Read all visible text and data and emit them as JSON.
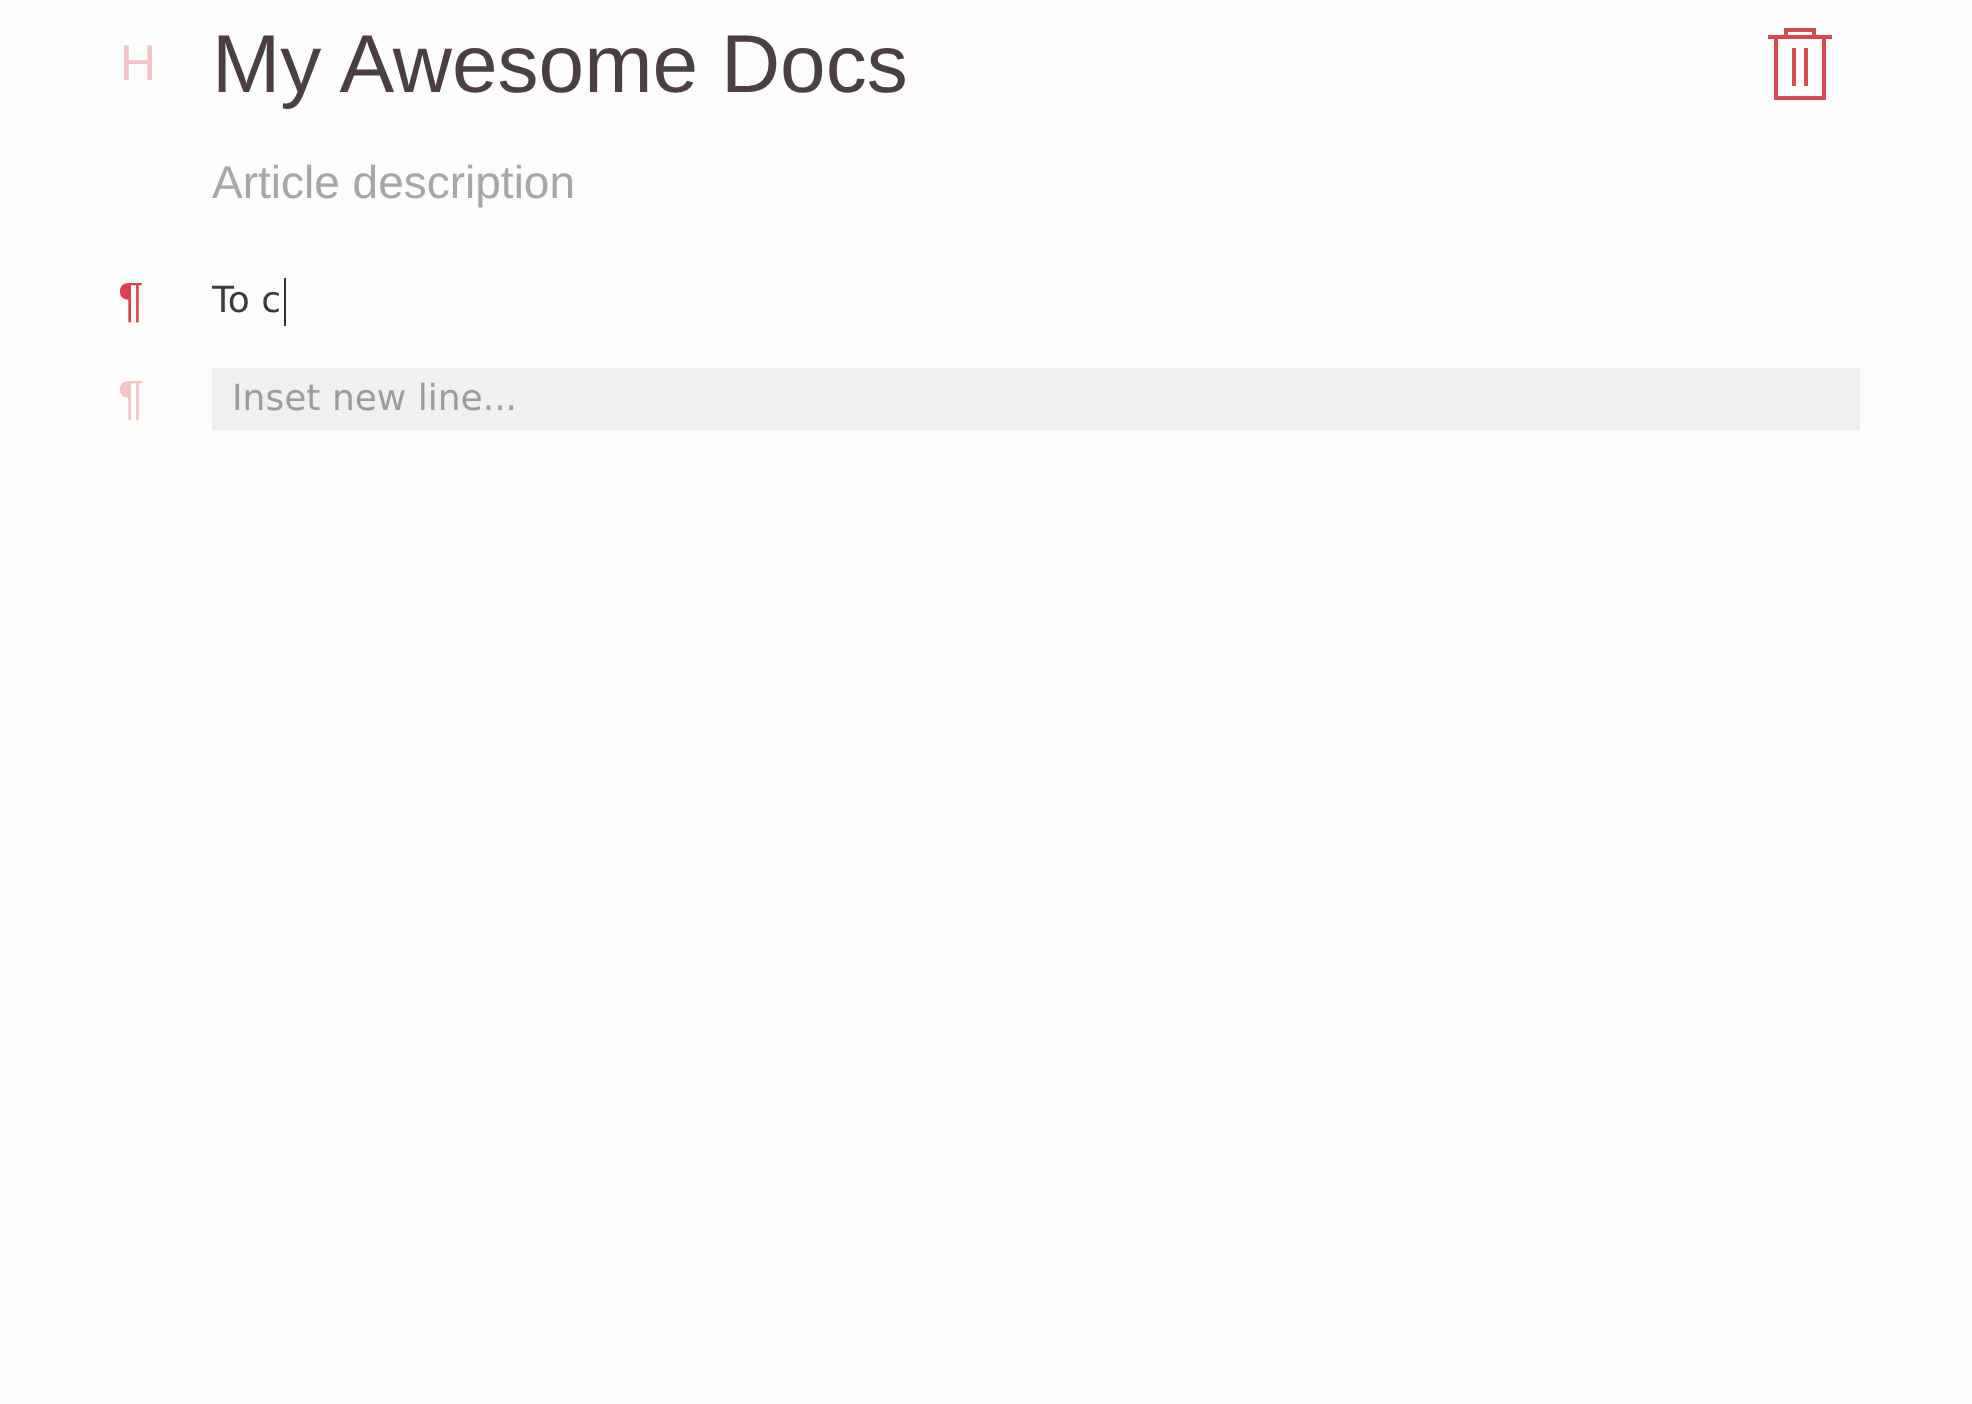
{
  "heading": {
    "marker": "H",
    "active": false,
    "title": "My Awesome Docs"
  },
  "description": {
    "placeholder": "Article description"
  },
  "blocks": [
    {
      "kind": "paragraph",
      "marker": "¶",
      "active": true,
      "text": "To c"
    },
    {
      "kind": "new_line",
      "marker": "¶",
      "active": false,
      "placeholder": "Inset new line..."
    }
  ]
}
